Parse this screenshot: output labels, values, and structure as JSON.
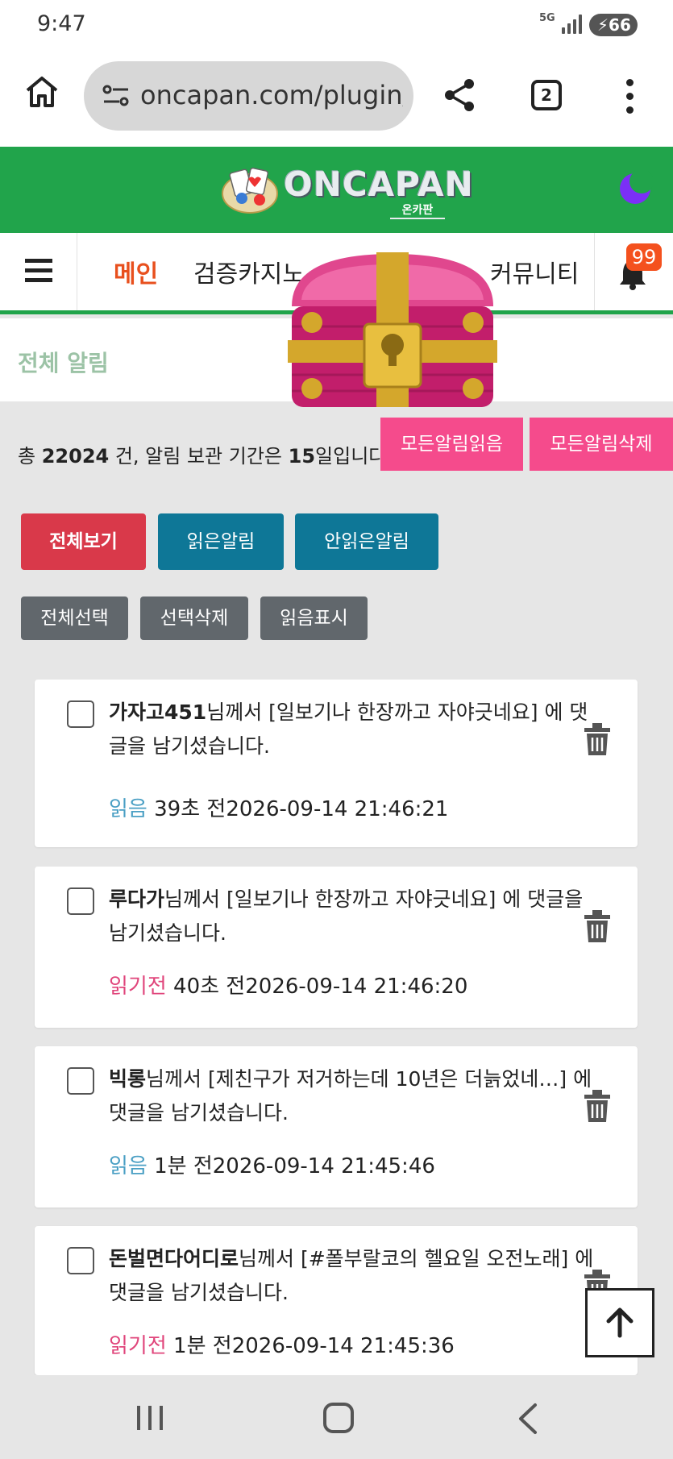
{
  "status_bar": {
    "time": "9:47",
    "network": "5G",
    "battery": "66"
  },
  "browser": {
    "url": "oncapan.com/plugin/",
    "tab_count": "2"
  },
  "site": {
    "logo_text": "ONCAPAN",
    "logo_sub": "온카판"
  },
  "nav": {
    "items": [
      "메인",
      "검증카지노",
      "커뮤니티"
    ],
    "notification_count": "99"
  },
  "page": {
    "title": "전체 알림",
    "summary_prefix": "총 ",
    "total": "22024",
    "summary_mid": " 건, 알림 보관 기간은 ",
    "days": "15",
    "summary_suffix": "일입니다."
  },
  "actions": {
    "read_all": "모든알림읽음",
    "delete_all": "모든알림삭제",
    "view_all": "전체보기",
    "read_filter": "읽은알림",
    "unread_filter": "안읽은알림",
    "select_all": "전체선택",
    "delete_selected": "선택삭제",
    "mark_read": "읽음표시"
  },
  "notifications": [
    {
      "user": "가자고451",
      "text": "님께서 [일보기나 한장까고 자야긋네요] 에 댓글을 남기셨습니다.",
      "status": "읽음",
      "read": true,
      "ago": " 39초 전",
      "datetime": "2026-09-14 21:46:21"
    },
    {
      "user": "루다가",
      "text": "님께서 [일보기나 한장까고 자야긋네요] 에 댓글을 남기셨습니다.",
      "status": "읽기전",
      "read": false,
      "ago": " 40초 전",
      "datetime": "2026-09-14 21:46:20"
    },
    {
      "user": "빅롱",
      "text": "님께서 [제친구가 저거하는데 10년은 더늙었네…] 에 댓글을 남기셨습니다.",
      "status": "읽음",
      "read": true,
      "ago": " 1분 전",
      "datetime": "2026-09-14 21:45:46"
    },
    {
      "user": "돈벌면다어디로",
      "text": "님께서 [#폴부랄코의 헬요일 오전노래] 에 댓글을 남기셨습니다.",
      "status": "읽기전",
      "read": false,
      "ago": " 1분 전",
      "datetime": "2026-09-14 21:45:36"
    }
  ],
  "colors": {
    "brand_green": "#21a44b",
    "accent_pink": "#f54b8c",
    "danger_red": "#d9394a",
    "teal": "#0e7797",
    "read_blue": "#4a9fc4",
    "unread_pink": "#e0457b"
  }
}
